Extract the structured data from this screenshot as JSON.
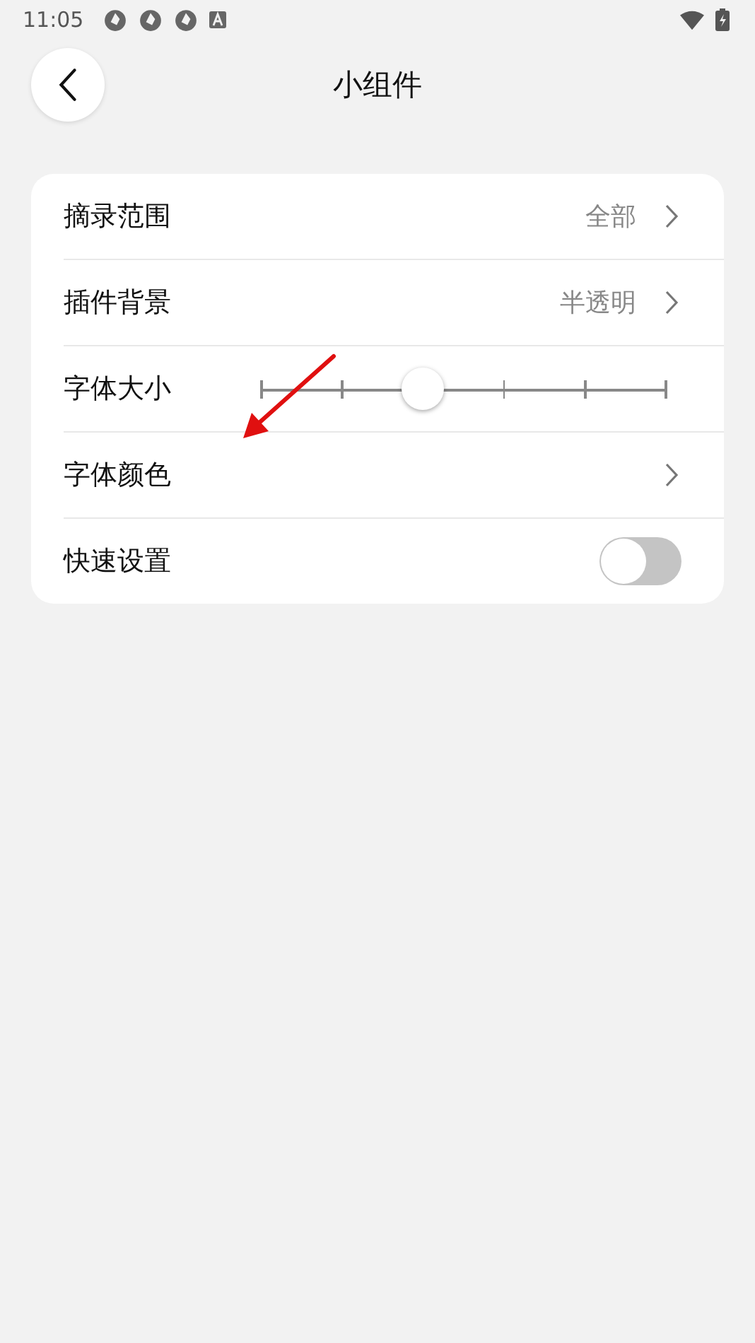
{
  "status_bar": {
    "time": "11:05"
  },
  "header": {
    "title": "小组件"
  },
  "settings": [
    {
      "kind": "value",
      "label": "摘录范围",
      "value": "全部"
    },
    {
      "kind": "value",
      "label": "插件背景",
      "value": "半透明"
    },
    {
      "kind": "slider",
      "label": "字体大小",
      "level": 0.4
    },
    {
      "kind": "link",
      "label": "字体颜色"
    },
    {
      "kind": "toggle",
      "label": "快速设置",
      "on": false
    }
  ]
}
